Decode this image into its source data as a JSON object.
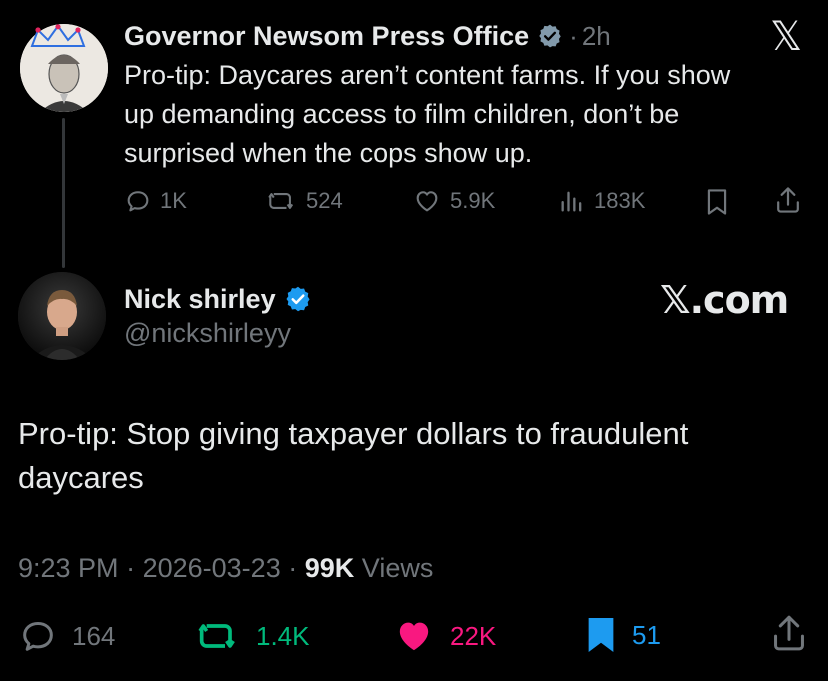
{
  "quoted_tweet": {
    "author_name": "Governor Newsom Press Office",
    "separator": "·",
    "time_ago": "2h",
    "text": "Pro-tip: Daycares aren’t content farms. If you show up demanding access to film children, don’t be surprised when the cops show up.",
    "text_lines": [
      "Pro-tip: Daycares aren’t content farms. If you show",
      "up demanding access to film children, don’t be",
      "surprised when the cops show up."
    ],
    "actions": {
      "replies": "1K",
      "reposts": "524",
      "likes": "5.9K",
      "views": "183K"
    },
    "verified_badge_color": "#829aab",
    "header_logo": "𝕏"
  },
  "main_tweet": {
    "author_name": "Nick shirley",
    "handle": "@nickshirleyy",
    "verified_badge_color": "#1d9bf0",
    "brand": "𝕏.com",
    "text_lines": [
      "Pro-tip: Stop giving taxpayer dollars to fraudulent",
      "daycares"
    ],
    "meta": {
      "time": "9:23 PM",
      "sep1": "·",
      "date": "2026-03-23",
      "sep2": "·",
      "views_count": "99K",
      "views_label": "Views"
    },
    "actions": {
      "replies": "164",
      "reposts": "1.4K",
      "likes": "22K",
      "bookmarks": "51"
    }
  },
  "colors": {
    "background": "#000000",
    "text": "#e7e9ea",
    "muted": "#71767b",
    "repost_active": "#00ba7c",
    "like_active": "#f91880",
    "bookmark_active": "#1d9bf0"
  }
}
